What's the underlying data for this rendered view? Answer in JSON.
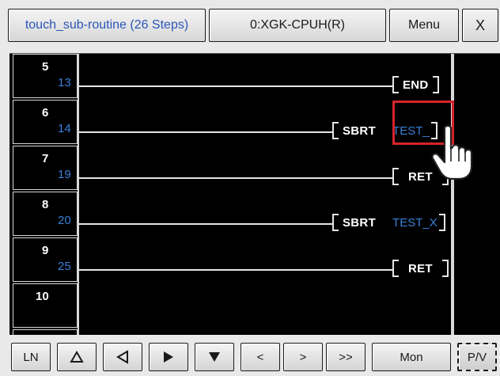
{
  "toolbar": {
    "title_label": "touch_sub-routine (26 Steps)",
    "cpu_label": "0:XGK-CPUH(R)",
    "menu_label": "Menu",
    "close_label": "X"
  },
  "rungs": [
    {
      "number": "5",
      "step": "13"
    },
    {
      "number": "6",
      "step": "14"
    },
    {
      "number": "7",
      "step": "19"
    },
    {
      "number": "8",
      "step": "20"
    },
    {
      "number": "9",
      "step": "25"
    },
    {
      "number": "10",
      "step": ""
    }
  ],
  "instructions": [
    {
      "op": "END",
      "arg": ""
    },
    {
      "op": "SBRT",
      "arg": "TEST_"
    },
    {
      "op": "RET",
      "arg": ""
    },
    {
      "op": "SBRT",
      "arg": "TEST_X"
    },
    {
      "op": "RET",
      "arg": ""
    }
  ],
  "bottom": {
    "ln_label": "LN",
    "prev_page_label": "<",
    "next_page_label": ">",
    "jump_label": ">>",
    "mon_label": "Mon",
    "pv_label": "P/V"
  },
  "colors": {
    "accent_blue": "#3a7fd8",
    "highlight_red": "#d6232a",
    "ladder_bg": "#000000"
  },
  "icons": [
    "up-triangle-icon",
    "left-triangle-icon",
    "right-triangle-icon",
    "down-triangle-icon",
    "pointing-hand-icon"
  ]
}
